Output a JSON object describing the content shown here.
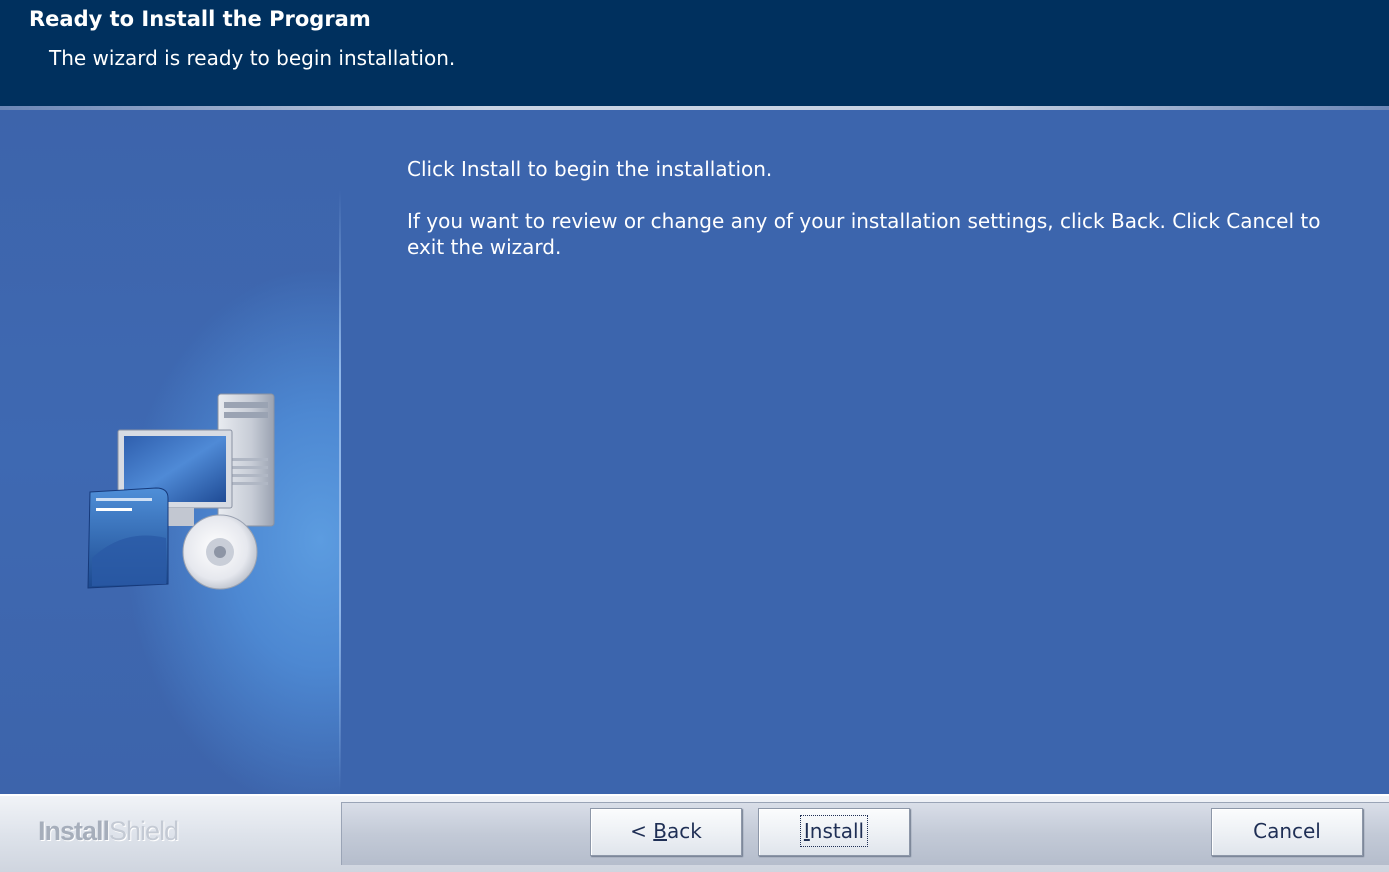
{
  "header": {
    "title": "Ready to Install the Program",
    "subtitle": "The wizard is ready to begin installation."
  },
  "main": {
    "line1": "Click Install to begin the installation.",
    "line2": "If you want to review or change any of your installation settings, click Back. Click Cancel to exit the wizard."
  },
  "illustration": {
    "icons": [
      "computer-tower-icon",
      "monitor-icon",
      "software-box-icon",
      "cd-disc-icon"
    ]
  },
  "footer": {
    "brand_part1": "Install",
    "brand_part2": "Shield",
    "back_prefix": "< ",
    "back_mnemonic": "B",
    "back_rest": "ack",
    "install_mnemonic": "I",
    "install_rest": "nstall",
    "cancel_label": "Cancel"
  },
  "colors": {
    "header_bg": "#00305e",
    "body_bg": "#3c65ad",
    "text": "#ffffff",
    "footer_bg": "#dde2ea"
  }
}
